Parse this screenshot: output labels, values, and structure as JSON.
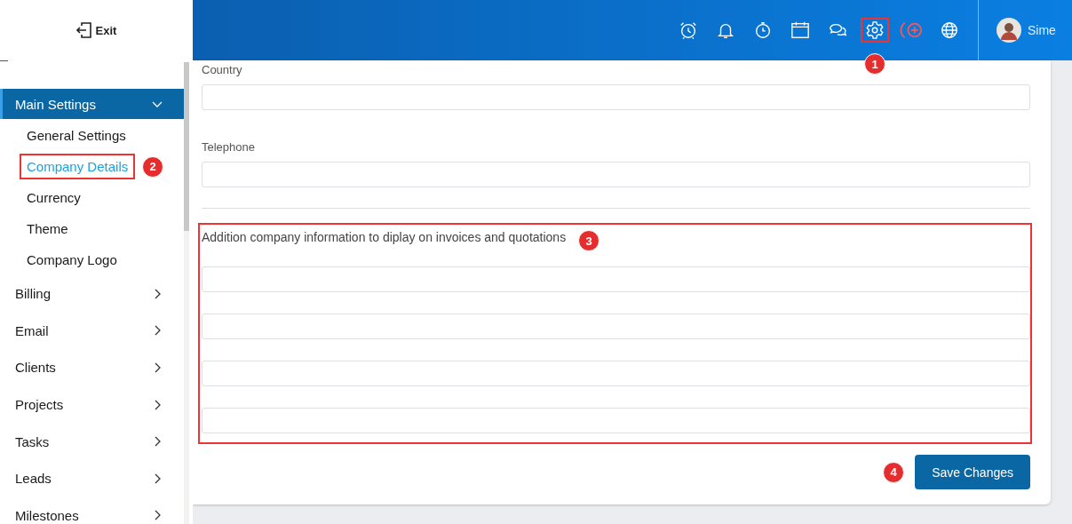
{
  "sidebar": {
    "exit_label": "Exit",
    "menu": [
      {
        "label": "Main Settings",
        "expanded": true,
        "selected": true,
        "children": [
          {
            "label": "General Settings",
            "selected": false,
            "highlighted": false
          },
          {
            "label": "Company Details",
            "selected": true,
            "highlighted": true,
            "callout": "2"
          },
          {
            "label": "Currency",
            "selected": false,
            "highlighted": false
          },
          {
            "label": "Theme",
            "selected": false,
            "highlighted": false
          },
          {
            "label": "Company Logo",
            "selected": false,
            "highlighted": false
          }
        ]
      },
      {
        "label": "Billing",
        "expanded": false,
        "selected": false
      },
      {
        "label": "Email",
        "expanded": false,
        "selected": false
      },
      {
        "label": "Clients",
        "expanded": false,
        "selected": false
      },
      {
        "label": "Projects",
        "expanded": false,
        "selected": false
      },
      {
        "label": "Tasks",
        "expanded": false,
        "selected": false
      },
      {
        "label": "Leads",
        "expanded": false,
        "selected": false
      },
      {
        "label": "Milestones",
        "expanded": false,
        "selected": false
      }
    ]
  },
  "header": {
    "icons": [
      {
        "kind": "alarm",
        "highlighted": false
      },
      {
        "kind": "bell",
        "highlighted": false
      },
      {
        "kind": "stopwatch",
        "highlighted": false
      },
      {
        "kind": "calendar",
        "highlighted": false
      },
      {
        "kind": "chat",
        "highlighted": false
      },
      {
        "kind": "gear",
        "highlighted": true,
        "callout": "1"
      },
      {
        "kind": "add-alert",
        "highlighted": false
      },
      {
        "kind": "globe",
        "highlighted": false
      }
    ],
    "user": {
      "name": "Sime"
    }
  },
  "form": {
    "fields": [
      {
        "label": "Country"
      },
      {
        "label": "Telephone"
      }
    ],
    "extra_section": {
      "label": "Addition company information to diplay on invoices and quotations",
      "highlighted": true,
      "callout": "3",
      "inputs": [
        {
          "kind": "text"
        },
        {
          "kind": "text"
        },
        {
          "kind": "text"
        },
        {
          "kind": "text"
        }
      ]
    },
    "save_button": {
      "label": "Save Changes",
      "callout": "4"
    }
  }
}
